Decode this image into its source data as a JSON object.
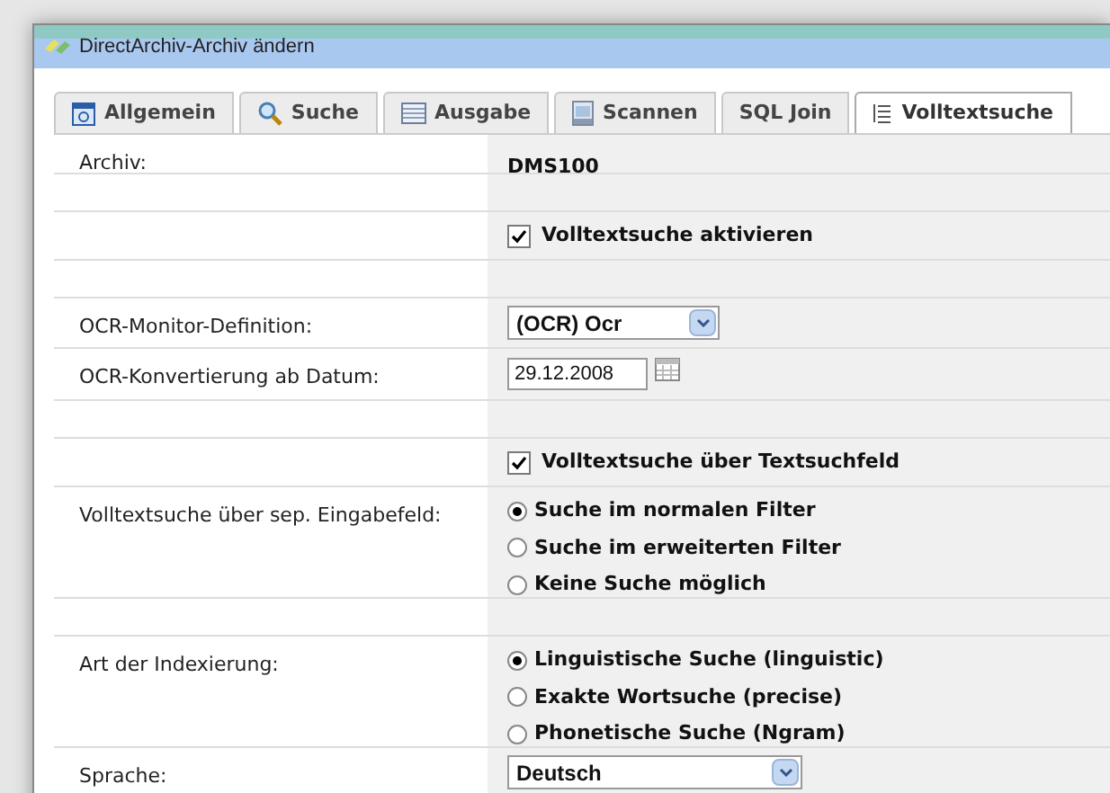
{
  "window": {
    "title": "DirectArchiv-Archiv ändern"
  },
  "tabs": [
    {
      "label": "Allgemein",
      "kind": "window",
      "selected": false
    },
    {
      "label": "Suche",
      "kind": "search",
      "selected": false
    },
    {
      "label": "Ausgabe",
      "kind": "table",
      "selected": false
    },
    {
      "label": "Scannen",
      "kind": "scanner",
      "selected": false
    },
    {
      "label": "SQL Join",
      "kind": "plain",
      "selected": false
    },
    {
      "label": "Volltextsuche",
      "kind": "list",
      "selected": true
    }
  ],
  "rows": [
    {
      "kind": "text",
      "label": "Archiv:",
      "value": "DMS100"
    },
    {
      "kind": "empty"
    },
    {
      "kind": "checkbox",
      "text": "Volltextsuche aktivieren",
      "checked": true
    },
    {
      "kind": "empty"
    },
    {
      "kind": "select",
      "label": "OCR-Monitor-Definition:",
      "value": "(OCR) Ocr"
    },
    {
      "kind": "date",
      "label": "OCR-Konvertierung ab Datum:",
      "value": "29.12.2008"
    },
    {
      "kind": "empty"
    },
    {
      "kind": "checkbox",
      "text": "Volltextsuche über Textsuchfeld",
      "checked": true
    },
    {
      "kind": "radio",
      "label": "Volltextsuche über sep. Eingabefeld:",
      "options": [
        {
          "label": "Suche im normalen Filter",
          "selected": true
        },
        {
          "label": "Suche im erweiterten Filter",
          "selected": false
        },
        {
          "label": "Keine Suche möglich",
          "selected": false
        }
      ]
    },
    {
      "kind": "empty"
    },
    {
      "kind": "radio",
      "label": "Art der Indexierung:",
      "options": [
        {
          "label": "Linguistische Suche (linguistic)",
          "selected": true
        },
        {
          "label": "Exakte Wortsuche (precise)",
          "selected": false
        },
        {
          "label": "Phonetische Suche (Ngram)",
          "selected": false
        }
      ]
    },
    {
      "kind": "wideselect",
      "label": "Sprache:",
      "value": "Deutsch"
    }
  ]
}
